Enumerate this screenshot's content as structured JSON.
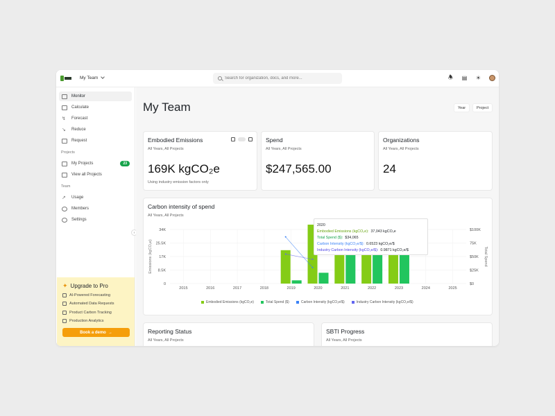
{
  "topbar": {
    "team_name": "My Team",
    "search_placeholder": "Search for organization, docs, and more..."
  },
  "sidebar": {
    "items": [
      {
        "label": "Monitor",
        "active": true
      },
      {
        "label": "Calculate"
      },
      {
        "label": "Forecast"
      },
      {
        "label": "Reduce"
      },
      {
        "label": "Request"
      }
    ],
    "projects_label": "Projects",
    "projects": [
      {
        "label": "My Projects",
        "badge": "23"
      },
      {
        "label": "View all Projects"
      }
    ],
    "team_label": "Team",
    "team_items": [
      {
        "label": "Usage"
      },
      {
        "label": "Members"
      },
      {
        "label": "Settings"
      }
    ],
    "promo": {
      "title": "Upgrade to Pro",
      "items": [
        "AI-Powered Forecasting",
        "Automated Data Requests",
        "Product Carbon Tracking",
        "Production Analytics"
      ],
      "cta": "Book a demo"
    }
  },
  "main": {
    "title": "My Team",
    "segments": [
      "Year",
      "Project"
    ],
    "cards": [
      {
        "title": "Embodied Emissions",
        "sub": "All Years, All Projects",
        "value": "169K kgCO₂e",
        "note": "Using industry emission factors only"
      },
      {
        "title": "Spend",
        "sub": "All Years, All Projects",
        "value": "$247,565.00"
      },
      {
        "title": "Organizations",
        "sub": "All Years, All Projects",
        "value": "24"
      }
    ],
    "bottom_cards": [
      {
        "title": "Reporting Status",
        "sub": "All Years, All Projects"
      },
      {
        "title": "SBTI Progress",
        "sub": "All Years, All Projects"
      }
    ]
  },
  "chart_data": {
    "type": "bar",
    "title": "Carbon intensity of spend",
    "subtitle": "All Years, All Projects",
    "categories": [
      "2015",
      "2016",
      "2017",
      "2018",
      "2019",
      "2020",
      "2021",
      "2022",
      "2023",
      "2024",
      "2025"
    ],
    "ylabel": "Emissions (kgCO₂e)",
    "ylabel_right": "Total Spend",
    "ylim": [
      0,
      34000
    ],
    "y_ticks": [
      "0",
      "8.5K",
      "17K",
      "25.5K",
      "34K"
    ],
    "ylim_right": [
      0,
      100000
    ],
    "y_ticks_right": [
      "$0",
      "$25K",
      "$50K",
      "75K",
      "$100K"
    ],
    "series": [
      {
        "name": "Embodied Emissions (kgCO₂e)",
        "color": "#84cc16",
        "values": [
          null,
          null,
          null,
          null,
          21000,
          37043,
          30000,
          31000,
          29000,
          null,
          null
        ]
      },
      {
        "name": "Total Spend ($)",
        "color": "#22c55e",
        "values": [
          null,
          null,
          null,
          null,
          6000,
          20000,
          90000,
          88000,
          90000,
          null,
          null
        ]
      },
      {
        "name": "Carbon Intensity (kgCO₂e/$)",
        "color": "#3b82f6",
        "values": [
          null,
          null,
          null,
          null,
          1.9,
          0.6523,
          null,
          null,
          null,
          null,
          null
        ]
      },
      {
        "name": "Industry Carbon Intensity (kgCO₂e/$)",
        "color": "#6366f1",
        "values": [
          null,
          null,
          null,
          null,
          1.2,
          0.9871,
          null,
          null,
          null,
          null,
          null
        ]
      }
    ],
    "tooltip": {
      "title": "2020",
      "rows": [
        {
          "label": "Embodied Emissions (kgCO₂e):",
          "value": "37,043 kgCO₂e",
          "color": "#65a30d"
        },
        {
          "label": "Total Spend ($):",
          "value": "$34,065",
          "color": "#16a34a"
        },
        {
          "label": "Carbon Intensity (kgCO₂e/$):",
          "value": "0.6523 kgCO₂e/$",
          "color": "#3b82f6"
        },
        {
          "label": "Industry Carbon Intensity (kgCO₂e/$):",
          "value": "0.9871 kgCO₂e/$",
          "color": "#4f46e5"
        }
      ]
    }
  }
}
